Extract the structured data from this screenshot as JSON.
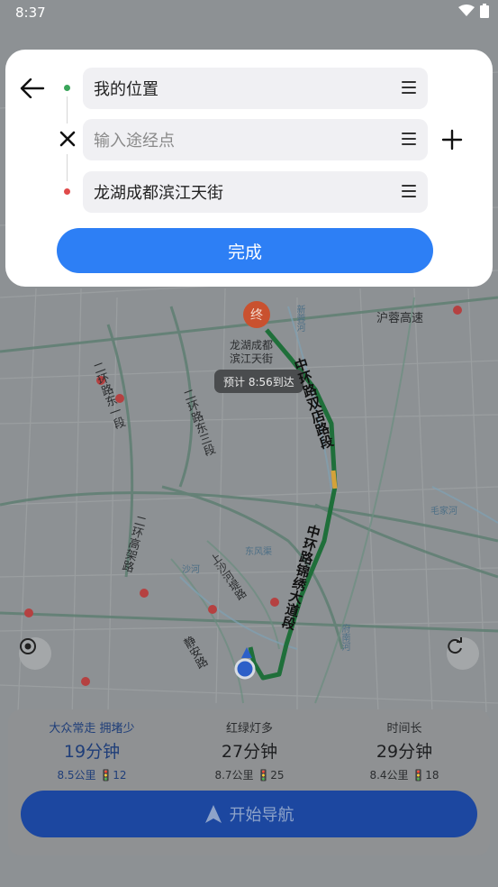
{
  "status_bar": {
    "time": "8:37"
  },
  "route_panel": {
    "origin": "我的位置",
    "waypoint_placeholder": "输入途经点",
    "destination": "龙湖成都滨江天街",
    "done_label": "完成"
  },
  "map": {
    "destination_marker": "终",
    "destination_label_line1": "龙湖成都",
    "destination_label_line2": "滨江天街",
    "eta": "预计 8:56到达",
    "roads": [
      "沪蓉高速",
      "二环路东一段",
      "二环路东三段",
      "二环高架路",
      "中环路双店路段",
      "中环路锦绣大道段",
      "上沙河堤路",
      "静安路",
      "新蓉河",
      "沙河",
      "东风渠",
      "毛家河",
      "府南河"
    ],
    "route_color": "#1f6f3a"
  },
  "route_options": [
    {
      "tag": "大众常走 拥堵少",
      "time": "19分钟",
      "info": "8.5公里 🚦12"
    },
    {
      "tag": "红绿灯多",
      "time": "27分钟",
      "info": "8.7公里 🚦25"
    },
    {
      "tag": "时间长",
      "time": "29分钟",
      "info": "8.4公里 🚦18"
    }
  ],
  "start_nav_label": "开始导航",
  "icons": [
    "back-arrow-icon",
    "close-icon",
    "plus-icon",
    "drag-handle-icon",
    "locate-icon",
    "refresh-icon",
    "navigation-arrow-icon",
    "wifi-icon",
    "battery-icon"
  ]
}
